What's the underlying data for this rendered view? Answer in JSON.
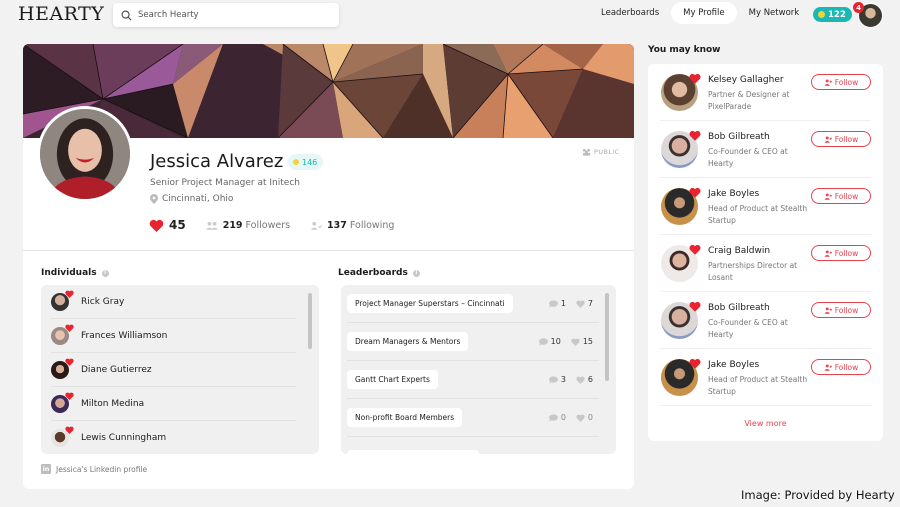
{
  "app": {
    "logo": "HEARTY",
    "search_placeholder": "Search Hearty"
  },
  "nav": {
    "items": [
      {
        "label": "Leaderboards",
        "active": false
      },
      {
        "label": "My Profile",
        "active": true
      },
      {
        "label": "My Network",
        "active": false
      }
    ],
    "coins": "122",
    "notifications": "4"
  },
  "colors": {
    "accent_red": "#e8424c",
    "teal": "#19b8b3",
    "coin_yellow": "#f4d23a"
  },
  "profile": {
    "name": "Jessica Alvarez",
    "coins": "146",
    "title": "Senior Project Manager at Initech",
    "location": "Cincinnati, Ohio",
    "hearts": "45",
    "followers_count": "219",
    "followers_label": "Followers",
    "following_count": "137",
    "following_label": "Following",
    "visibility": "PUBLIC",
    "linkedin_label": "Jessica's Linkedin profile"
  },
  "individuals": {
    "title": "Individuals",
    "items": [
      {
        "name": "Rick Gray"
      },
      {
        "name": "Frances Williamson"
      },
      {
        "name": "Diane Gutierrez"
      },
      {
        "name": "Milton Medina"
      },
      {
        "name": "Lewis Cunningham"
      }
    ]
  },
  "leaderboards": {
    "title": "Leaderboards",
    "items": [
      {
        "name": "Project Manager Superstars – Cincinnati",
        "comments": "1",
        "likes": "7"
      },
      {
        "name": "Dream Managers & Mentors",
        "comments": "10",
        "likes": "15"
      },
      {
        "name": "Gantt Chart Experts",
        "comments": "3",
        "likes": "6"
      },
      {
        "name": "Non-profit Board Members",
        "comments": "0",
        "likes": "0"
      },
      {
        "name": "",
        "comments": "",
        "likes": ""
      }
    ]
  },
  "you_may_know": {
    "title": "You may know",
    "follow_label": "Follow",
    "view_more": "View more",
    "people": [
      {
        "name": "Kelsey Gallagher",
        "role": "Partner & Designer at PixelParade"
      },
      {
        "name": "Bob Gilbreath",
        "role": "Co-Founder & CEO at Hearty"
      },
      {
        "name": "Jake Boyles",
        "role": "Head of Product at Stealth Startup"
      },
      {
        "name": "Craig Baldwin",
        "role": "Partnerships Director at Losant"
      },
      {
        "name": "Bob Gilbreath",
        "role": "Co-Founder & CEO at Hearty"
      },
      {
        "name": "Jake Boyles",
        "role": "Head of Product at Stealth Startup"
      }
    ]
  },
  "credit": "Image: Provided by Hearty"
}
